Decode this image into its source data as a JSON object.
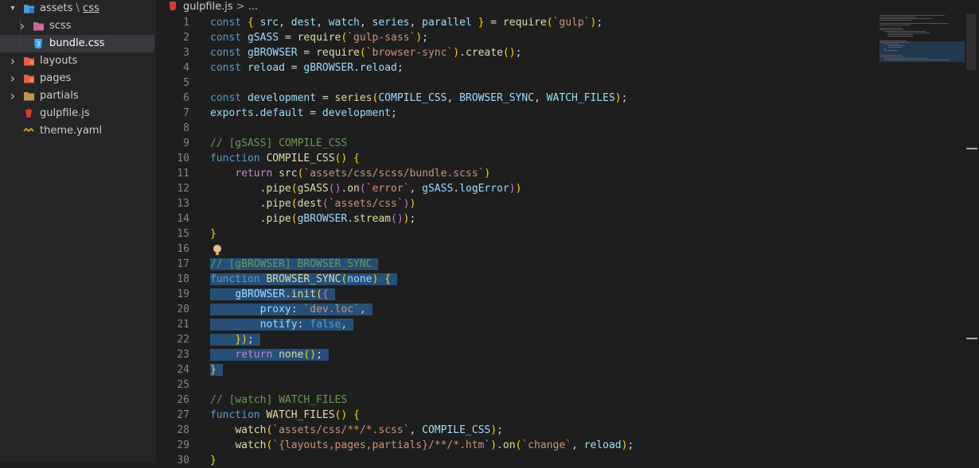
{
  "explorer": {
    "items": [
      {
        "label": "assets",
        "sublabel": "css",
        "sep": " \\ ",
        "icon": "folder-css-open-icon",
        "chevron": "▾",
        "depth": 0
      },
      {
        "label": "scss",
        "icon": "folder-sass-icon",
        "chevron": "›",
        "depth": 1
      },
      {
        "label": "bundle.css",
        "icon": "css-file-icon",
        "chevron": "",
        "depth": 1,
        "active": true
      },
      {
        "label": "layouts",
        "icon": "folder-layouts-icon",
        "chevron": "›",
        "depth": 0
      },
      {
        "label": "pages",
        "icon": "folder-pages-icon",
        "chevron": "›",
        "depth": 0
      },
      {
        "label": "partials",
        "icon": "folder-icon",
        "chevron": "›",
        "depth": 0
      },
      {
        "label": "gulpfile.js",
        "icon": "gulp-file-icon",
        "chevron": "",
        "depth": 0
      },
      {
        "label": "theme.yaml",
        "icon": "yaml-file-icon",
        "chevron": "",
        "depth": 0
      }
    ]
  },
  "breadcrumb": {
    "file": "gulpfile.js",
    "separator": ">",
    "more": "..."
  },
  "editor": {
    "lines": [
      {
        "n": "1",
        "text": "const { src, dest, watch, series, parallel } = require(`gulp`);"
      },
      {
        "n": "2",
        "text": "const gSASS = require(`gulp-sass`);"
      },
      {
        "n": "3",
        "text": "const gBROWSER = require(`browser-sync`).create();"
      },
      {
        "n": "4",
        "text": "const reload = gBROWSER.reload;"
      },
      {
        "n": "5",
        "text": ""
      },
      {
        "n": "6",
        "text": "const development = series(COMPILE_CSS, BROWSER_SYNC, WATCH_FILES);"
      },
      {
        "n": "7",
        "text": "exports.default = development;"
      },
      {
        "n": "8",
        "text": ""
      },
      {
        "n": "9",
        "text": "// [gSASS] COMPILE_CSS"
      },
      {
        "n": "10",
        "text": "function COMPILE_CSS() {"
      },
      {
        "n": "11",
        "text": "    return src(`assets/css/scss/bundle.scss`)"
      },
      {
        "n": "12",
        "text": "        .pipe(gSASS().on(`error`, gSASS.logError))"
      },
      {
        "n": "13",
        "text": "        .pipe(dest(`assets/css`))"
      },
      {
        "n": "14",
        "text": "        .pipe(gBROWSER.stream());"
      },
      {
        "n": "15",
        "text": "}"
      },
      {
        "n": "16",
        "text": ""
      },
      {
        "n": "17",
        "text": "// [gBROWSER] BROWSER_SYNC"
      },
      {
        "n": "18",
        "text": "function BROWSER_SYNC(none) {"
      },
      {
        "n": "19",
        "text": "    gBROWSER.init({"
      },
      {
        "n": "20",
        "text": "        proxy: `dev.loc`,"
      },
      {
        "n": "21",
        "text": "        notify: false,"
      },
      {
        "n": "22",
        "text": "    });"
      },
      {
        "n": "23",
        "text": "    return none();"
      },
      {
        "n": "24",
        "text": "}"
      },
      {
        "n": "25",
        "text": ""
      },
      {
        "n": "26",
        "text": "// [watch] WATCH_FILES"
      },
      {
        "n": "27",
        "text": "function WATCH_FILES() {"
      },
      {
        "n": "28",
        "text": "    watch(`assets/css/**/*.scss`, COMPILE_CSS);"
      },
      {
        "n": "29",
        "text": "    watch(`{layouts,pages,partials}/**/*.htm`).on(`change`, reload);"
      },
      {
        "n": "30",
        "text": "}"
      }
    ],
    "selection": {
      "from_line": 17,
      "to_line": 24
    },
    "lightbulb_line": 16
  },
  "colors": {
    "accent_selection": "#264f78",
    "keyword": "#569cd6",
    "string": "#ce9178",
    "function": "#dcdcaa",
    "variable": "#9cdcfe",
    "comment": "#6a9955"
  }
}
